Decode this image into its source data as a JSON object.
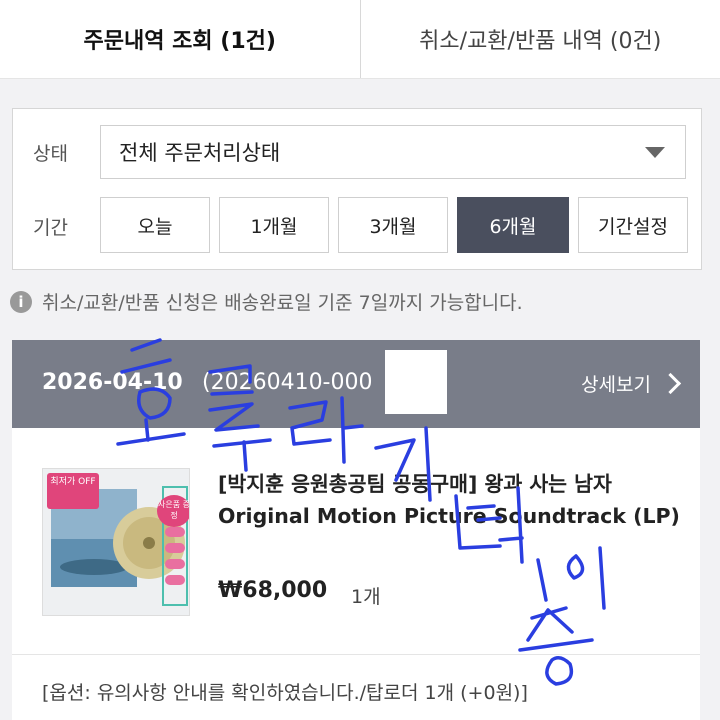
{
  "tabs": [
    {
      "label": "주문내역 조회 (1건)",
      "active": true
    },
    {
      "label": "취소/교환/반품 내역 (0건)",
      "active": false
    }
  ],
  "filter": {
    "status_label": "상태",
    "status_value": "전체 주문처리상태",
    "period_label": "기간",
    "period_options": [
      "오늘",
      "1개월",
      "3개월",
      "6개월",
      "기간설정"
    ],
    "period_selected": "6개월"
  },
  "notice": {
    "icon": "info-icon",
    "text": "취소/교환/반품 신청은 배송완료일 기준 7일까지 가능합니다."
  },
  "order": {
    "date": "2026-04-10",
    "number": "(20260410-000",
    "number_tail": ")",
    "detail_label": "상세보기",
    "item": {
      "name": "[박지훈 응원총공팀 공동구매] 왕과 사는 남자 Original Motion Picture Soundtrack (LP)",
      "price": "₩68,000",
      "qty": "1개",
      "thumb_badge_left": "최저가 OFF",
      "thumb_badge_right": "사은품 증정",
      "option": "[옵션: 유의사항 안내를 확인하였습니다./탑로더 1개 (+0원)]"
    }
  },
  "overlay": {
    "handwritten_stamp": "흐루라기 구매 인증",
    "stamp_color": "#2a3ee0"
  },
  "colors": {
    "active_period_bg": "#4a4f5e",
    "order_header_bg": "#797d89"
  }
}
